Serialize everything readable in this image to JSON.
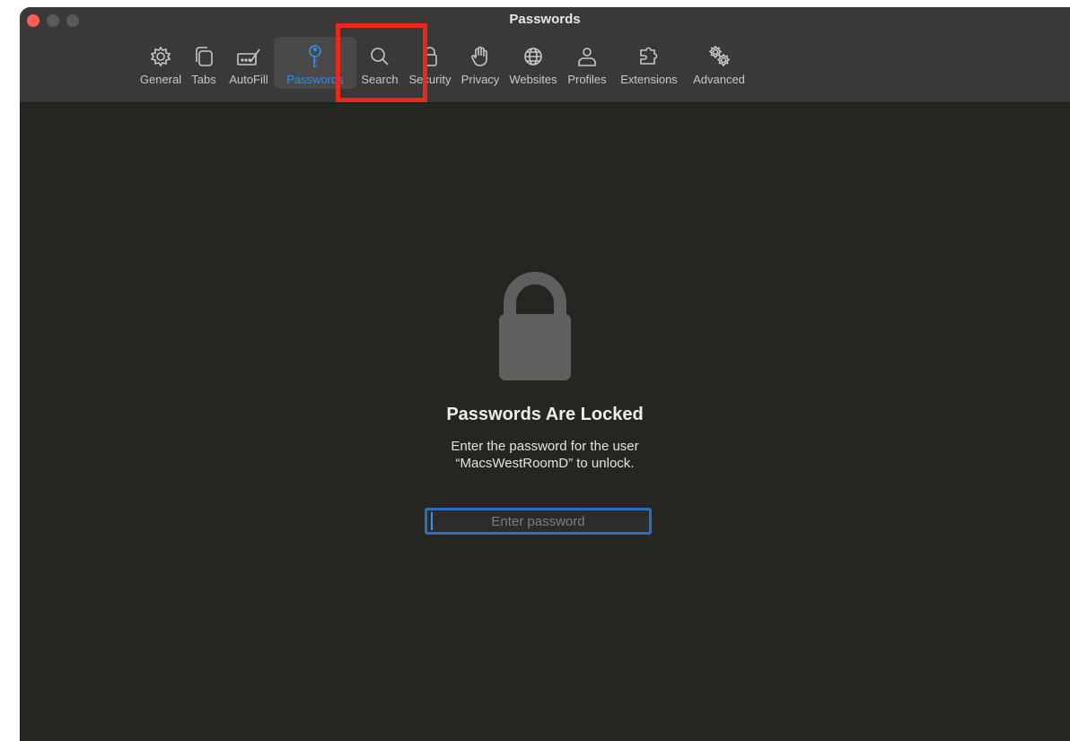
{
  "window": {
    "title": "Passwords"
  },
  "toolbar": {
    "tabs": [
      {
        "id": "general",
        "label": "General",
        "icon": "gear-icon"
      },
      {
        "id": "tabs",
        "label": "Tabs",
        "icon": "tabs-icon"
      },
      {
        "id": "autofill",
        "label": "AutoFill",
        "icon": "autofill-icon"
      },
      {
        "id": "passwords",
        "label": "Passwords",
        "icon": "key-icon",
        "active": true
      },
      {
        "id": "search",
        "label": "Search",
        "icon": "magnifier-icon"
      },
      {
        "id": "security",
        "label": "Security",
        "icon": "lock-icon"
      },
      {
        "id": "privacy",
        "label": "Privacy",
        "icon": "hand-icon"
      },
      {
        "id": "websites",
        "label": "Websites",
        "icon": "globe-icon"
      },
      {
        "id": "profiles",
        "label": "Profiles",
        "icon": "person-icon"
      },
      {
        "id": "extensions",
        "label": "Extensions",
        "icon": "puzzle-icon"
      },
      {
        "id": "advanced",
        "label": "Advanced",
        "icon": "gears-icon"
      }
    ]
  },
  "content": {
    "title": "Passwords Are Locked",
    "message_line1": "Enter the password for the user",
    "message_line2": "“MacsWestRoomD” to unlock.",
    "password_placeholder": "Enter password",
    "password_value": ""
  },
  "colors": {
    "accent": "#2f8cf0",
    "highlight_box": "#e8291c",
    "background": "#252522",
    "titlebar": "#3a3937"
  }
}
